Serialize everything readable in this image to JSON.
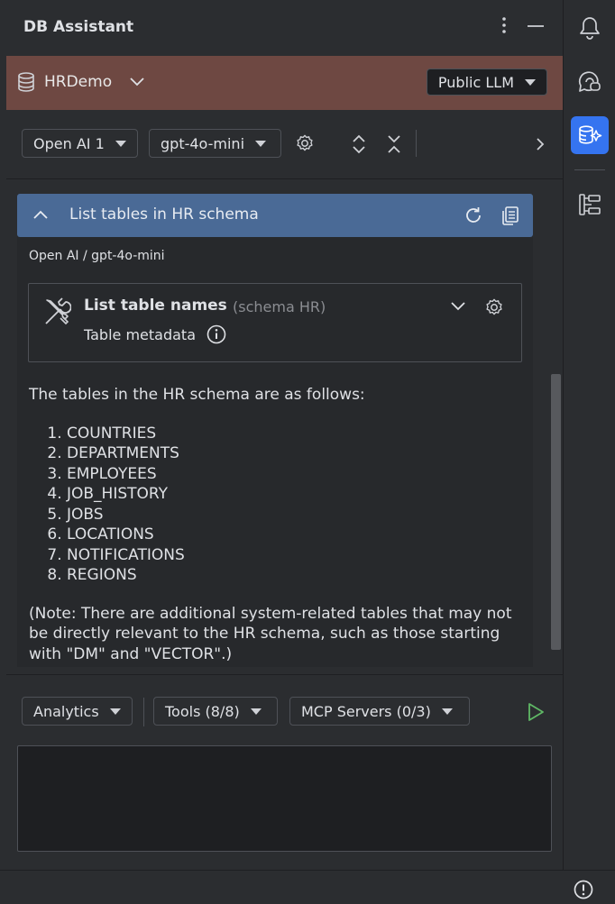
{
  "header": {
    "title": "DB Assistant",
    "more_icon": "more-vertical-icon",
    "minimize_icon": "minimize-icon"
  },
  "connection": {
    "name": "HRDemo",
    "llm_mode": "Public LLM",
    "bar_color": "#6e4842"
  },
  "toolbar": {
    "provider": "Open AI 1",
    "model": "gpt-4o-mini"
  },
  "chat": {
    "title": "List tables in HR schema",
    "header_color": "#4a6a96",
    "provider_label": "Open AI / gpt-4o-mini",
    "tool_call": {
      "name": "List table names",
      "schema": "(schema HR)",
      "description": "Table metadata"
    },
    "answer_intro": "The tables in the HR schema are as follows:",
    "tables": [
      "COUNTRIES",
      "DEPARTMENTS",
      "EMPLOYEES",
      "JOB_HISTORY",
      "JOBS",
      "LOCATIONS",
      "NOTIFICATIONS",
      "REGIONS"
    ],
    "answer_note": "(Note: There are additional system-related tables that may not be directly relevant to the HR schema, such as those starting with \"DM\" and \"VECTOR\".)"
  },
  "bottom": {
    "analytics": "Analytics",
    "tools": "Tools (8/8)",
    "mcp": "MCP Servers (0/3)",
    "run_color": "#5fb865"
  },
  "sidebar": {
    "accent": "#3574f0",
    "icons": [
      "bell-icon",
      "ai-chat-icon",
      "db-assistant-icon",
      "structure-icon"
    ]
  },
  "status": {
    "icon": "warning-icon"
  }
}
